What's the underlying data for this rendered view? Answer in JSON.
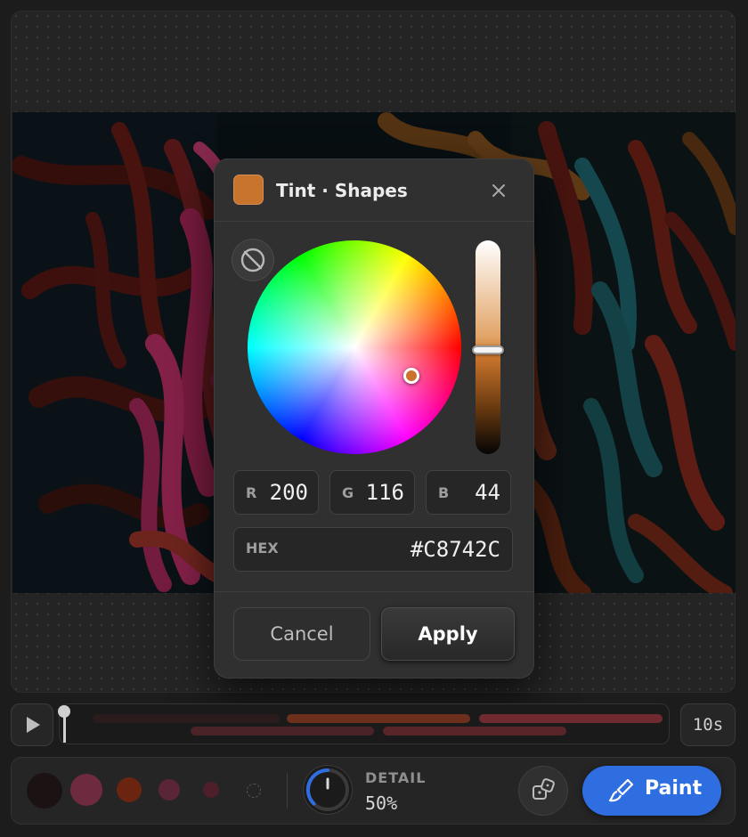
{
  "dialog": {
    "title": "Tint · Shapes",
    "close_icon": "close-icon",
    "no_color_icon": "no-color-icon",
    "current_color": "#C8742C",
    "rgb": [
      {
        "label": "R",
        "value": "200"
      },
      {
        "label": "G",
        "value": "116"
      },
      {
        "label": "B",
        "value": "44"
      }
    ],
    "hex": {
      "label": "HEX",
      "value": "#C8742C"
    },
    "value_level": 0.5,
    "cancel_label": "Cancel",
    "apply_label": "Apply"
  },
  "timeline": {
    "play_icon": "play-icon",
    "duration": "10s",
    "track_colors": [
      "#2a1c1c",
      "#6b2f1b",
      "#6e2a2e",
      "#4a2327",
      "#5a2529"
    ]
  },
  "toolbar": {
    "brushes": [
      {
        "color": "#1a1213"
      },
      {
        "color": "#6e2a3e"
      },
      {
        "color": "#6a2410"
      },
      {
        "color": "#5a2537"
      },
      {
        "color": "#4e1e2a"
      },
      {
        "color": "none"
      }
    ],
    "detail_label": "DETAIL",
    "detail_value": "50%",
    "detail_level": 0.5,
    "randomize_icon": "dice-icon",
    "paint_label": "Paint",
    "paint_icon": "brush-icon",
    "accent": "#2F6EE0"
  }
}
